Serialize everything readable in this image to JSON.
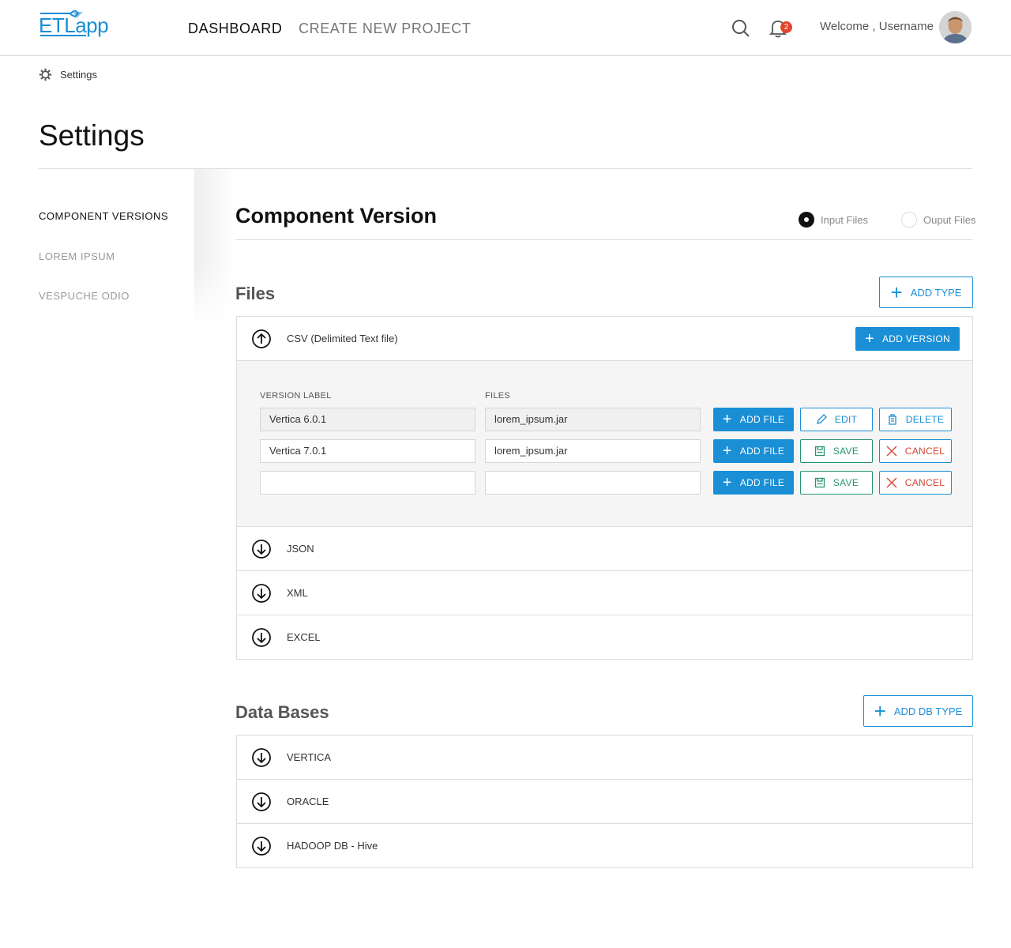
{
  "header": {
    "logo": {
      "part1": "ETL",
      "part2": "app"
    },
    "nav": {
      "dashboard": "DASHBOARD",
      "create": "CREATE NEW PROJECT"
    },
    "notifications_count": "2",
    "welcome": "Welcome , Username"
  },
  "breadcrumb": {
    "label": "Settings"
  },
  "page_title": "Settings",
  "sidebar": {
    "items": [
      {
        "label": "COMPONENT VERSIONS",
        "active": true
      },
      {
        "label": "LOREM IPSUM",
        "active": false
      },
      {
        "label": "VESPUCHE ODIO",
        "active": false
      }
    ]
  },
  "main": {
    "title": "Component Version",
    "radio": {
      "input": "Input Files",
      "output": "Ouput Files",
      "selected": "input"
    },
    "files": {
      "title": "Files",
      "add_type": "ADD TYPE",
      "csv": {
        "label": "CSV (Delimited Text file)",
        "add_version": "ADD VERSION"
      },
      "columns": {
        "version": "VERSION LABEL",
        "files": "FILES"
      },
      "versions": [
        {
          "version": "Vertica 6.0.1",
          "file": "lorem_ipsum.jar",
          "add": "ADD FILE",
          "a2": "EDIT",
          "a3": "DELETE"
        },
        {
          "version": "Vertica 7.0.1",
          "file": "lorem_ipsum.jar",
          "add": "ADD FILE",
          "a2": "SAVE",
          "a3": "CANCEL"
        },
        {
          "version": "",
          "file": "",
          "add": "ADD FILE",
          "a2": "SAVE",
          "a3": "CANCEL"
        }
      ],
      "types": [
        "JSON",
        "XML",
        "EXCEL"
      ]
    },
    "databases": {
      "title": "Data Bases",
      "add_db": "ADD DB TYPE",
      "types": [
        "VERTICA",
        "ORACLE",
        "HADOOP DB - Hive"
      ]
    }
  },
  "colors": {
    "accent": "#1a8fd6",
    "save": "#27956a",
    "cancel": "#d64530",
    "badge": "#e2452a"
  }
}
